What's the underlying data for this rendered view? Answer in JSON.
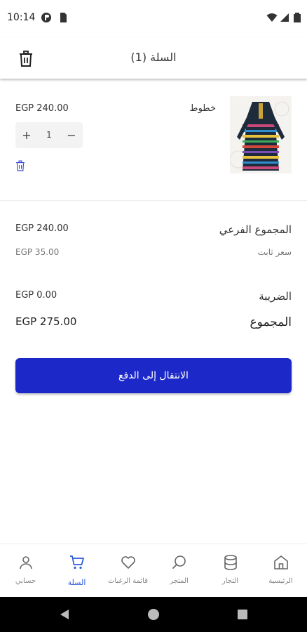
{
  "status_bar": {
    "time": "10:14"
  },
  "header": {
    "title": "السلة (1)"
  },
  "cart_item": {
    "name": "خطوط",
    "price": "EGP 240.00",
    "quantity": "1",
    "plus": "+",
    "minus": "−"
  },
  "summary": {
    "subtotal_label": "المجموع الفرعي",
    "subtotal_value": "EGP 240.00",
    "shipping_label": "سعر ثابت",
    "shipping_value": "EGP 35.00",
    "tax_label": "الضريبة",
    "tax_value": "EGP 0.00",
    "total_label": "المجموع",
    "total_value": "EGP 275.00"
  },
  "checkout_button": "الانتقال إلى الدفع",
  "bottom_nav": {
    "home": "الرئيسية",
    "vendors": "التجار",
    "store": "المتجر",
    "wishlist": "قائمة الرغبات",
    "cart": "السلة",
    "account": "حسابي"
  },
  "colors": {
    "primary": "#1c29c8",
    "active_nav": "#2a5ad8"
  },
  "icons": [
    "wifi-icon",
    "signal-icon",
    "battery-icon",
    "trash-icon",
    "home-icon",
    "database-icon",
    "search-icon",
    "heart-icon",
    "cart-icon",
    "user-icon"
  ]
}
